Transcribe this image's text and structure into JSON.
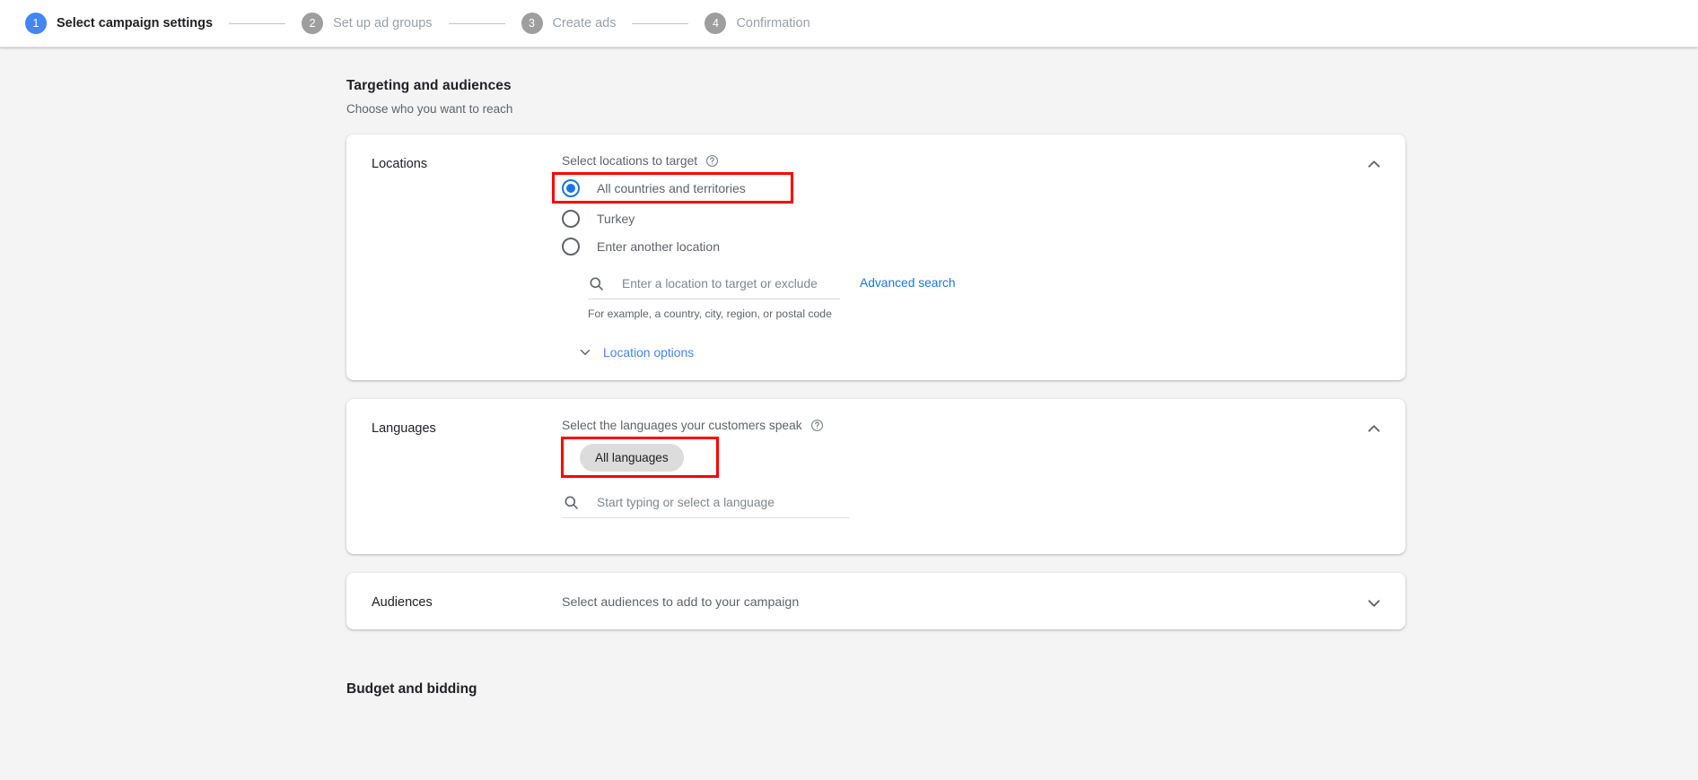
{
  "stepper": {
    "steps": [
      {
        "num": "1",
        "label": "Select campaign settings",
        "state": "active"
      },
      {
        "num": "2",
        "label": "Set up ad groups",
        "state": "inactive"
      },
      {
        "num": "3",
        "label": "Create ads",
        "state": "inactive"
      },
      {
        "num": "4",
        "label": "Confirmation",
        "state": "inactive"
      }
    ]
  },
  "targeting": {
    "title": "Targeting and audiences",
    "subtitle": "Choose who you want to reach"
  },
  "locations": {
    "label": "Locations",
    "heading": "Select locations to target",
    "help_icon": "help-circle-icon",
    "collapse_icon": "chevron-up-icon",
    "options": [
      {
        "label": "All countries and territories",
        "selected": true,
        "highlighted": true
      },
      {
        "label": "Turkey",
        "selected": false,
        "highlighted": false
      },
      {
        "label": "Enter another location",
        "selected": false,
        "highlighted": false
      }
    ],
    "search_placeholder": "Enter a location to target or exclude",
    "search_value": "",
    "search_icon": "search-icon",
    "hint": "For example, a country, city, region, or postal code",
    "advanced_search_label": "Advanced search",
    "location_options_label": "Location options",
    "location_options_icon": "chevron-down-icon"
  },
  "languages": {
    "label": "Languages",
    "heading": "Select the languages your customers speak",
    "help_icon": "help-circle-icon",
    "collapse_icon": "chevron-up-icon",
    "chip_label": "All languages",
    "chip_highlighted": true,
    "search_placeholder": "Start typing or select a language",
    "search_value": "",
    "search_icon": "search-icon"
  },
  "audiences": {
    "label": "Audiences",
    "description": "Select audiences to add to your campaign",
    "expand_icon": "chevron-down-icon"
  },
  "budget": {
    "title": "Budget and bidding"
  },
  "colors": {
    "accent_blue": "#1a73e8",
    "step_active": "#4285f4",
    "step_inactive": "#9e9e9e",
    "link_blue": "#4285f4",
    "highlight_red": "#ff0000",
    "chip_gray": "#dcdcdc",
    "page_bg": "#f4f4f4",
    "card_bg": "#ffffff",
    "text_primary": "#202124",
    "text_secondary": "#5f6368"
  }
}
